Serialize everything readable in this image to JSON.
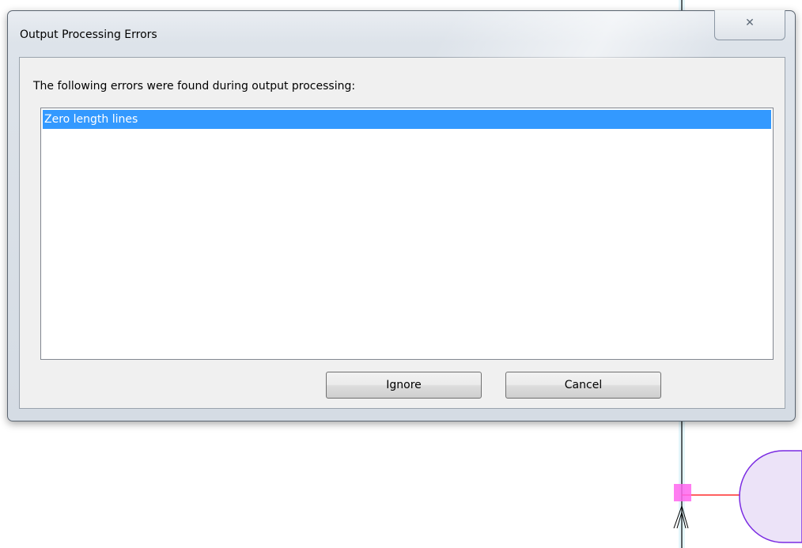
{
  "dialog": {
    "title": "Output Processing Errors",
    "close_icon": "close-icon",
    "close_glyph": "✕",
    "message": "The following errors were found during output processing:",
    "errors": [
      "Zero length lines"
    ],
    "selected_index": 0,
    "buttons": {
      "ignore_label": "Ignore",
      "cancel_label": "Cancel"
    }
  },
  "colors": {
    "selection": "#3399ff",
    "canvas_line": "#ff0000",
    "canvas_shape_stroke": "#7a2be2",
    "canvas_shape_fill": "#ece3f8",
    "canvas_marker": "#ff66ee"
  }
}
